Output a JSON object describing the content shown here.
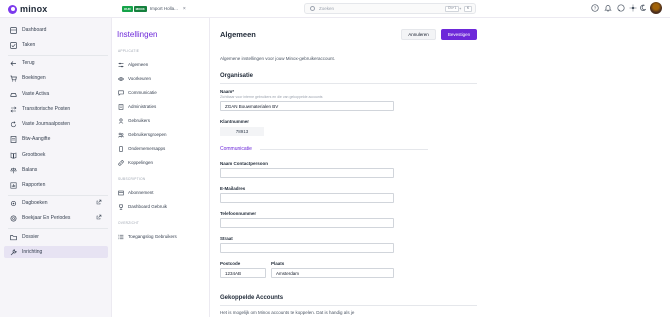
{
  "app": {
    "name": "minox"
  },
  "tab": {
    "badge1": "OUD",
    "badge2": "MOCK",
    "title": "Import Holla...",
    "close": "×"
  },
  "search": {
    "placeholder": "Zoeken",
    "shortcut_ctrl": "Ctrl",
    "shortcut_plus": "+",
    "shortcut_k": "K"
  },
  "sidebar": {
    "items": [
      {
        "label": "Dashboard",
        "icon": "dashboard-icon"
      },
      {
        "label": "Taken",
        "icon": "check-square-icon"
      },
      {
        "label": "Terug",
        "icon": "arrow-left-icon"
      },
      {
        "label": "Boekingen",
        "icon": "cart-icon"
      },
      {
        "label": "Vaste Activa",
        "icon": "car-icon"
      },
      {
        "label": "Transitorische Posten",
        "icon": "arrows-icon"
      },
      {
        "label": "Vaste Journaalposten",
        "icon": "refresh-icon"
      },
      {
        "label": "Btw-Aangifte",
        "icon": "invoice-icon"
      },
      {
        "label": "Grootboek",
        "icon": "book-icon"
      },
      {
        "label": "Balans",
        "icon": "scale-icon"
      },
      {
        "label": "Rapporten",
        "icon": "report-icon"
      },
      {
        "label": "Dagboeken",
        "icon": "gear-icon"
      },
      {
        "label": "Boekjaar En Periodes",
        "icon": "settings-icon"
      },
      {
        "label": "Dossier",
        "icon": "folder-icon"
      },
      {
        "label": "Inrichting",
        "icon": "wrench-icon"
      }
    ]
  },
  "settings": {
    "title": "Instellingen",
    "sections": {
      "applicatie": "APPLICATIE",
      "subscription": "SUBSCRIPTION",
      "overzicht": "OVERZICHT"
    },
    "items": [
      {
        "label": "Algemeen",
        "icon": "sliders-icon"
      },
      {
        "label": "Voorkeuren",
        "icon": "eye-icon"
      },
      {
        "label": "Communicatie",
        "icon": "chat-icon"
      },
      {
        "label": "Administraties",
        "icon": "building-icon"
      },
      {
        "label": "Gebruikers",
        "icon": "user-icon"
      },
      {
        "label": "Gebruikersgroepen",
        "icon": "users-icon"
      },
      {
        "label": "Ondernemersapps",
        "icon": "phone-icon"
      },
      {
        "label": "Koppelingen",
        "icon": "link-icon"
      },
      {
        "label": "Abonnement",
        "icon": "receipt-icon"
      },
      {
        "label": "Dashboard Gebruik",
        "icon": "trophy-icon"
      },
      {
        "label": "Toegangslog Gebruikers",
        "icon": "list-icon"
      }
    ]
  },
  "main": {
    "title": "Algemeen",
    "cancel_label": "Annuleren",
    "confirm_label": "Bevestigen",
    "intro": "Algemene instellingen voor jouw Minox-gebruikeraccount.",
    "org_title": "Organisatie",
    "name_label": "Naam*",
    "name_hint": "Zichtbaar voor interne gebruikers en die van gekoppelde accounts",
    "name_value": "ZGAN Bouwmaterialen BV",
    "client_label": "Klantnummer",
    "client_value": "78913",
    "comm_title": "Communicatie",
    "contact_label": "Naam Contactpersoon",
    "contact_value": "",
    "email_label": "E-Mailadres",
    "email_value": "",
    "phone_label": "Telefoonnummer",
    "phone_value": "",
    "street_label": "Straat",
    "street_value": "",
    "postcode_label": "Postcode",
    "postcode_value": "1234AB",
    "city_label": "Plaats",
    "city_value": "Amsterdam",
    "linked_title": "Gekoppelde Accounts",
    "linked_text": "Het is mogelijk om Minox accounts te koppelen. Dat is handig als je"
  },
  "colors": {
    "accent": "#6d28d9",
    "sidebar_bg": "#f6f5f9",
    "active_bg": "#e7e3f3"
  }
}
